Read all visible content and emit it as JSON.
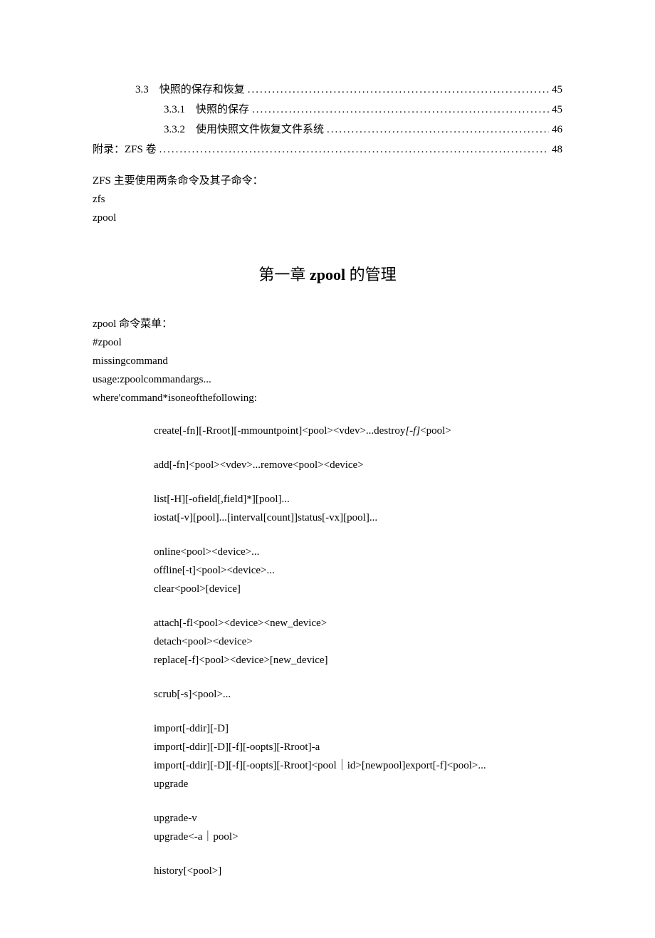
{
  "toc": {
    "e1": {
      "num": "3.3",
      "title": "快照的保存和恢复",
      "page": "45"
    },
    "e2": {
      "num": "3.3.1",
      "title": "快照的保存",
      "page": "45"
    },
    "e3": {
      "num": "3.3.2",
      "title": "使用快照文件恢复文件系统",
      "page": "46"
    },
    "e4": {
      "title": "附录：ZFS 卷",
      "page": "48"
    }
  },
  "intro": {
    "l1": "ZFS 主要使用两条命令及其子命令：",
    "l2": "zfs",
    "l3": "zpool"
  },
  "chapter_title_pre": "第一章 ",
  "chapter_title_bold": "zpool",
  "chapter_title_post": " 的管理",
  "menu": {
    "l1": "zpool 命令菜单：",
    "l2": "#zpool",
    "l3": "missingcommand",
    "l4": "usage:zpoolcommandargs...",
    "l5": "where'command*isoneofthefollowing:"
  },
  "cmds": {
    "g1l1a": "create[-fn][-Rroot][-mmountpoint]<pool><vdev>...destroy",
    "g1l1b": "[-f]",
    "g1l1c": "<pool>",
    "g2l1": "add[-fn]<pool><vdev>...remove<pool><device>",
    "g3l1": "list[-H][-ofield[,field]*][pool]...",
    "g3l2": "iostat[-v][pool]...[interval[count]]status[-vx][pool]...",
    "g4l1": "online<pool><device>...",
    "g4l2": "offline[-t]<pool><device>...",
    "g4l3": "clear<pool>[device]",
    "g5l1": "attach[-fl<pool><device><new_device>",
    "g5l2": "detach<pool><device>",
    "g5l3": "replace[-f]<pool><device>[new_device]",
    "g6l1": "scrub[-s]<pool>...",
    "g7l1": "import[-ddir][-D]",
    "g7l2": "import[-ddir][-D][-f][-oopts][-Rroot]-a",
    "g7l3": "import[-ddir][-D][-f][-oopts][-Rroot]<pool｜id>[newpool]export[-f]<pool>...",
    "g7l4": "upgrade",
    "g8l1": "upgrade-v",
    "g8l2": "upgrade<-a｜pool>",
    "g9l1": "history[<pool>]"
  }
}
